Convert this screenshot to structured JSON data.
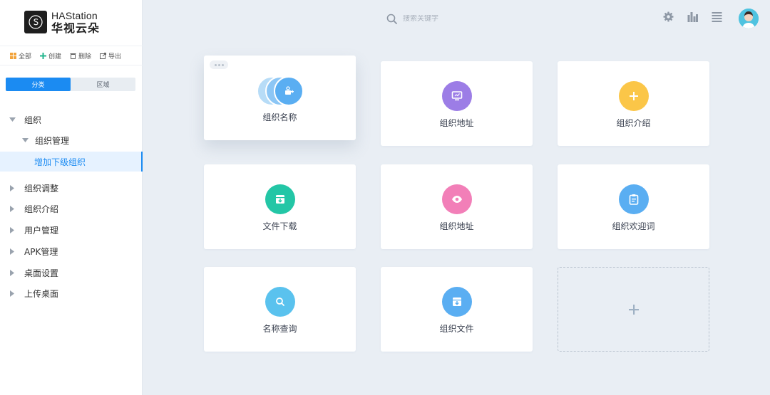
{
  "brand": {
    "en": "HAStation",
    "cn": "华视云朵"
  },
  "toolbar": {
    "all": "全部",
    "create": "创建",
    "delete": "删除",
    "export": "导出"
  },
  "segment": {
    "category": "分类",
    "region": "区域"
  },
  "tree": {
    "org": "组织",
    "org_manage": "组织管理",
    "add_sub_org": "增加下级组织",
    "org_adjust": "组织调整",
    "org_intro": "组织介绍",
    "user_manage": "用户管理",
    "apk_manage": "APK管理",
    "desktop_settings": "桌面设置",
    "upload_desktop": "上传桌面"
  },
  "header": {
    "search_placeholder": "搜索关键字"
  },
  "cards": [
    {
      "label": "组织名称",
      "icon": "people-stack-icon",
      "color": "#5aaef2"
    },
    {
      "label": "组织地址",
      "icon": "monitor-icon",
      "color": "#9c7de6"
    },
    {
      "label": "组织介绍",
      "icon": "plus-icon",
      "color": "#fbc648"
    },
    {
      "label": "文件下载",
      "icon": "download-icon",
      "color": "#23c6a6"
    },
    {
      "label": "组织地址",
      "icon": "eye-icon",
      "color": "#f27fb8"
    },
    {
      "label": "组织欢迎词",
      "icon": "clipboard-icon",
      "color": "#5aaef2"
    },
    {
      "label": "名称查询",
      "icon": "search-icon",
      "color": "#5ac2ee"
    },
    {
      "label": "组织文件",
      "icon": "file-icon",
      "color": "#5aaef2"
    }
  ],
  "colors": {
    "accent": "#1b8bf2",
    "background": "#e9eef4"
  }
}
